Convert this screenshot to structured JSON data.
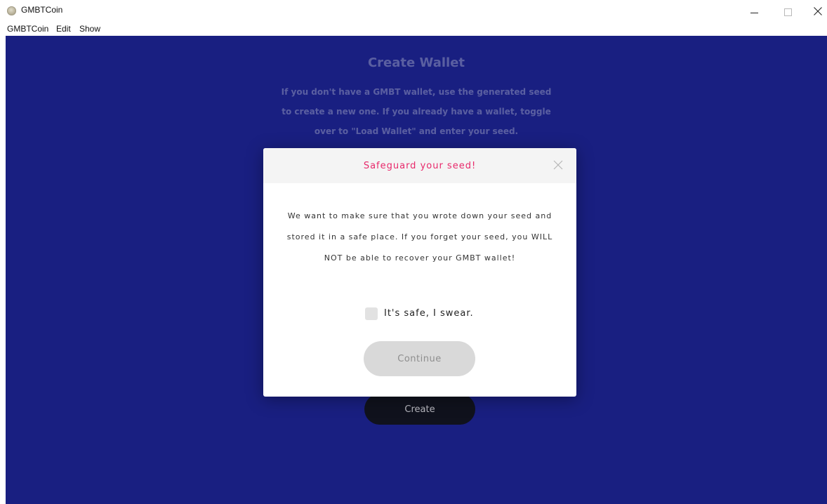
{
  "window": {
    "title": "GMBTCoin",
    "icon": "coin-app-icon",
    "controls": [
      "minimize-icon",
      "maximize-icon",
      "close-icon"
    ]
  },
  "menu": [
    {
      "label": "GMBTCoin"
    },
    {
      "label": "Edit"
    },
    {
      "label": "Show"
    }
  ],
  "page": {
    "title": "Create Wallet",
    "description_lines": [
      "If you don't have a GMBT wallet, use the generated seed",
      "to create a new one. If you already have a wallet, toggle",
      "over to \"Load Wallet\" and enter your seed."
    ],
    "create_label": "Create"
  },
  "modal": {
    "title": "Safeguard your seed!",
    "close_icon": "close-icon",
    "body_lines": [
      "We want to make sure that you wrote down your seed and",
      "stored it in a safe place. If you forget your seed, you WILL",
      "NOT be able to recover your GMBT wallet!"
    ],
    "checkbox_label": "It's safe, I swear.",
    "checkbox_checked": false,
    "continue_label": "Continue"
  },
  "colors": {
    "background": "#1a2190",
    "modal_title": "#e8286a",
    "create_button": "#0f1217",
    "continue_button_disabled": "#d9d9d9"
  }
}
